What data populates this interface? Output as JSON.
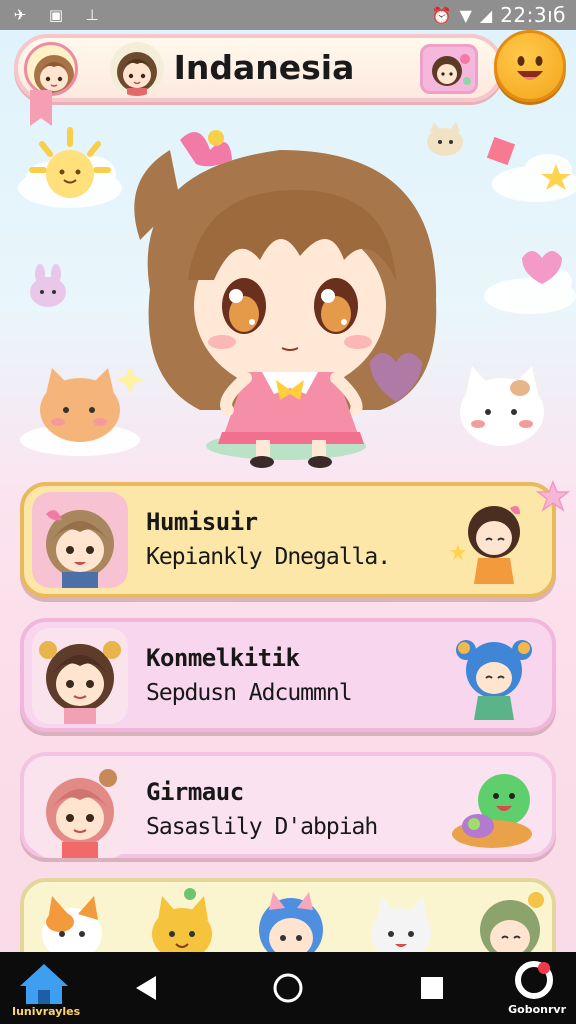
{
  "status_bar": {
    "time": "22:3ıб",
    "left_icons": [
      "app-icon",
      "image-icon",
      "notification-icon"
    ],
    "right_icons": [
      "alarm-icon",
      "wifi-icon",
      "signal-icon"
    ]
  },
  "header": {
    "title": "Indanesia"
  },
  "cards": [
    {
      "title": "Humisuir",
      "subtitle": "Kepiankly Dnegalla."
    },
    {
      "title": "Konmelkitik",
      "subtitle": "Sepdusn Adcummnl"
    },
    {
      "title": "Girmauc",
      "subtitle": "Sasaslily D'abpiah"
    }
  ],
  "nav": {
    "home_label": "Iunivrayles",
    "app_label": "Gobonrvr"
  },
  "colors": {
    "accent_pink": "#f7c6ca",
    "accent_yellow": "#f3a51c",
    "card_1": "#fde7a8",
    "card_2": "#f8d6ee",
    "card_3": "#fae2f1"
  }
}
